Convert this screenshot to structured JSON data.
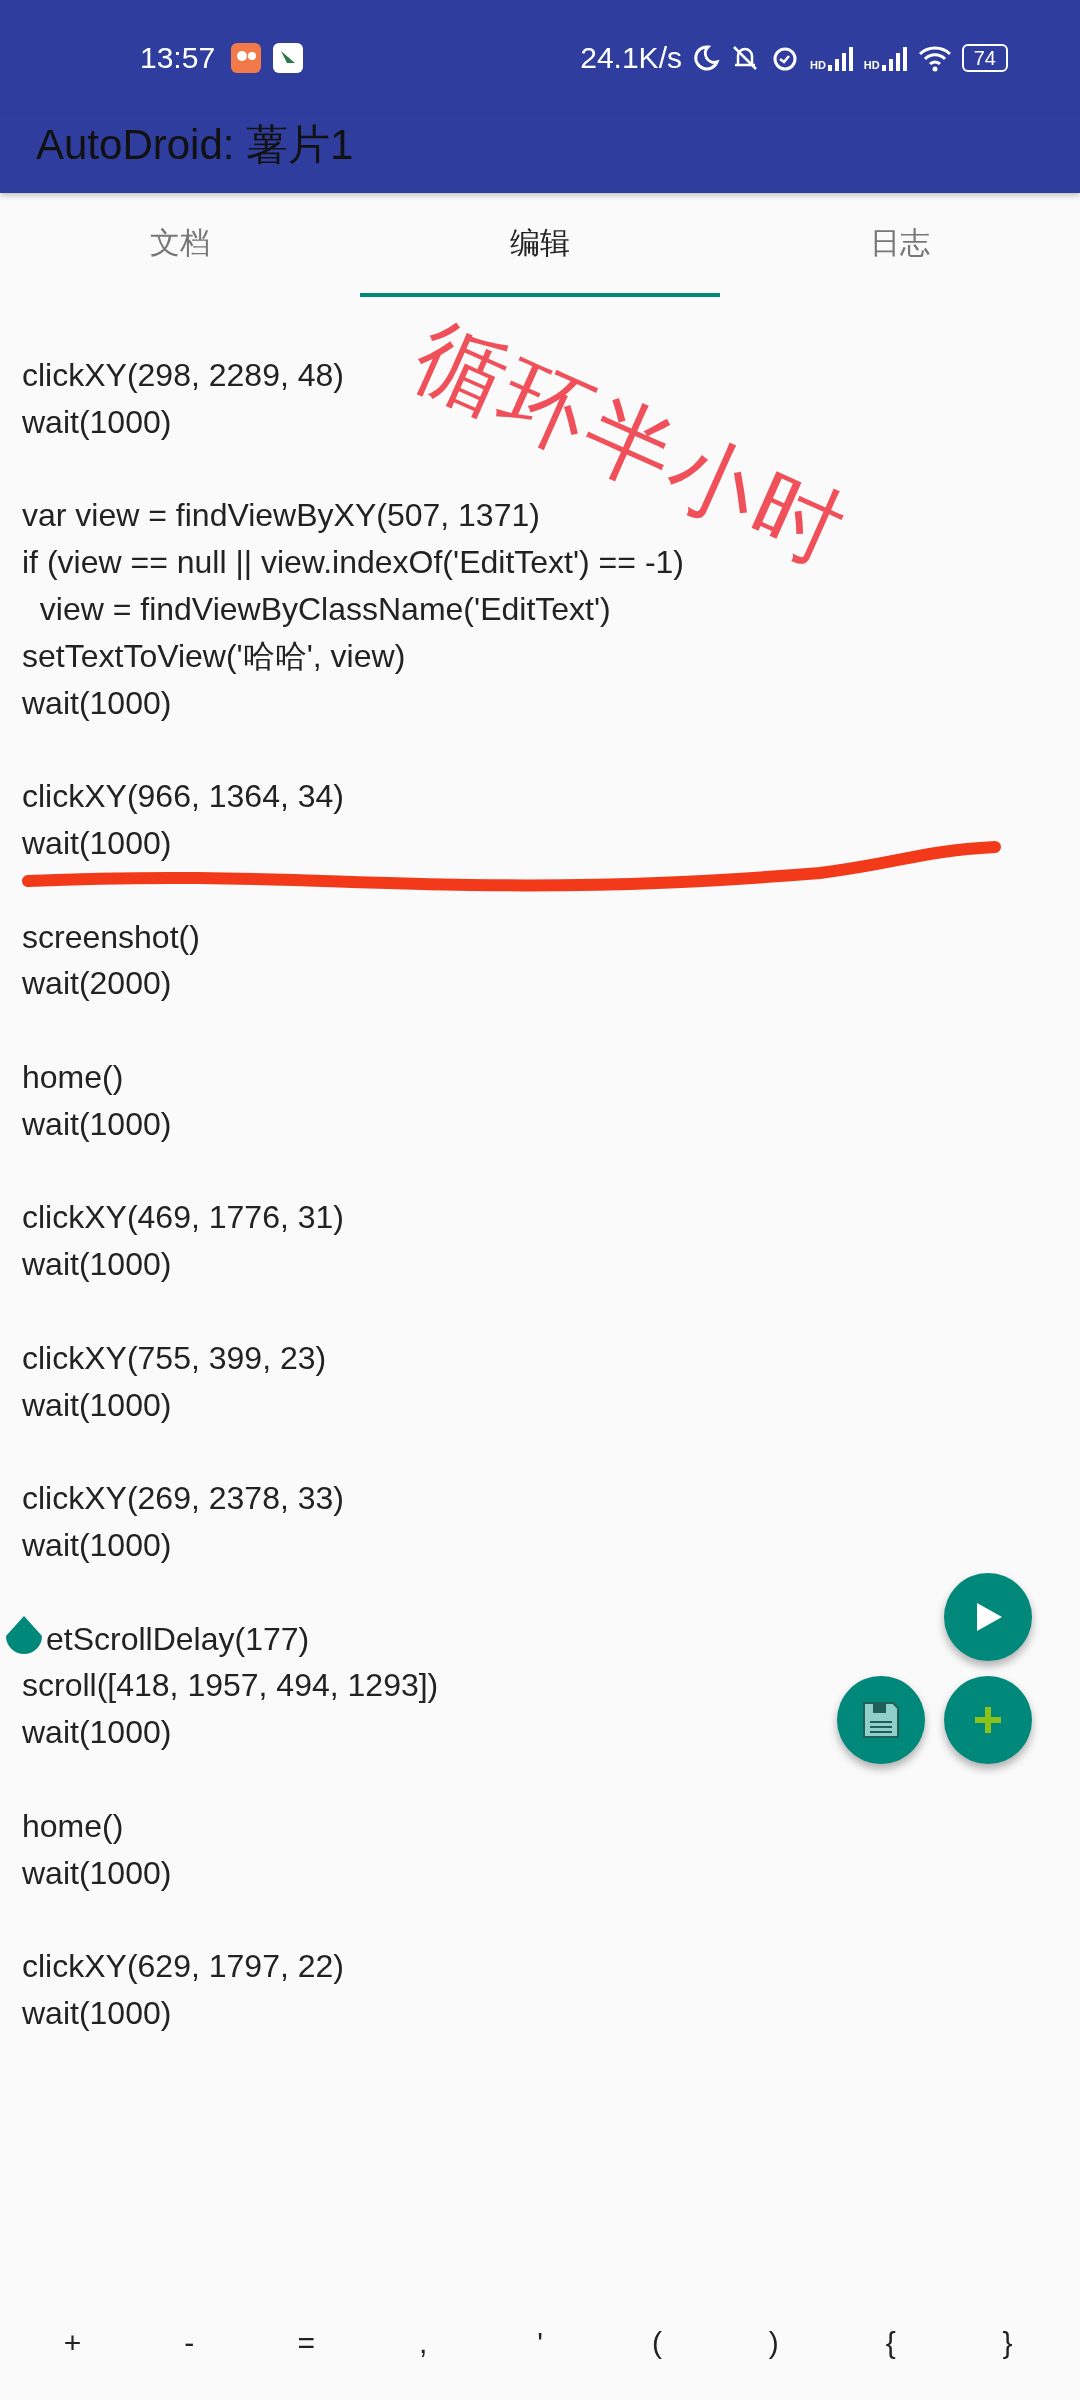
{
  "status_bar": {
    "time": "13:57",
    "net_speed": "24.1K/s",
    "signal_labels": [
      "HD",
      "HD"
    ],
    "battery": "74"
  },
  "app_bar": {
    "title": "AutoDroid: 薯片1"
  },
  "tabs": [
    {
      "label": "文档",
      "selected": false
    },
    {
      "label": "编辑",
      "selected": true
    },
    {
      "label": "日志",
      "selected": false
    }
  ],
  "code_blocks": [
    {
      "lines": [
        "clickXY(298, 2289, 48)",
        "wait(1000)"
      ],
      "cursor_handle": false
    },
    {
      "lines": [
        "var view = findViewByXY(507, 1371)",
        "if (view == null || view.indexOf('EditText') == -1)",
        "  view = findViewByClassName('EditText')",
        "setTextToView('哈哈', view)",
        "wait(1000)"
      ],
      "cursor_handle": false
    },
    {
      "lines": [
        "clickXY(966, 1364, 34)",
        "wait(1000)"
      ],
      "cursor_handle": false
    },
    {
      "lines": [
        "screenshot()",
        "wait(2000)"
      ],
      "cursor_handle": false
    },
    {
      "lines": [
        "home()",
        "wait(1000)"
      ],
      "cursor_handle": false
    },
    {
      "lines": [
        "clickXY(469, 1776, 31)",
        "wait(1000)"
      ],
      "cursor_handle": false
    },
    {
      "lines": [
        "clickXY(755, 399, 23)",
        "wait(1000)"
      ],
      "cursor_handle": false
    },
    {
      "lines": [
        "clickXY(269, 2378, 33)",
        "wait(1000)"
      ],
      "cursor_handle": false
    },
    {
      "lines": [
        "etScrollDelay(177)",
        "scroll([418, 1957, 494, 1293])",
        "wait(1000)"
      ],
      "cursor_handle": true
    },
    {
      "lines": [
        "home()",
        "wait(1000)"
      ],
      "cursor_handle": false
    },
    {
      "lines": [
        "clickXY(629, 1797, 22)",
        "wait(1000)"
      ],
      "cursor_handle": false
    }
  ],
  "annotation": {
    "text": "循环半小时"
  },
  "keys": [
    "+",
    "-",
    "=",
    ",",
    "'",
    "(",
    ")",
    "{",
    "}"
  ]
}
